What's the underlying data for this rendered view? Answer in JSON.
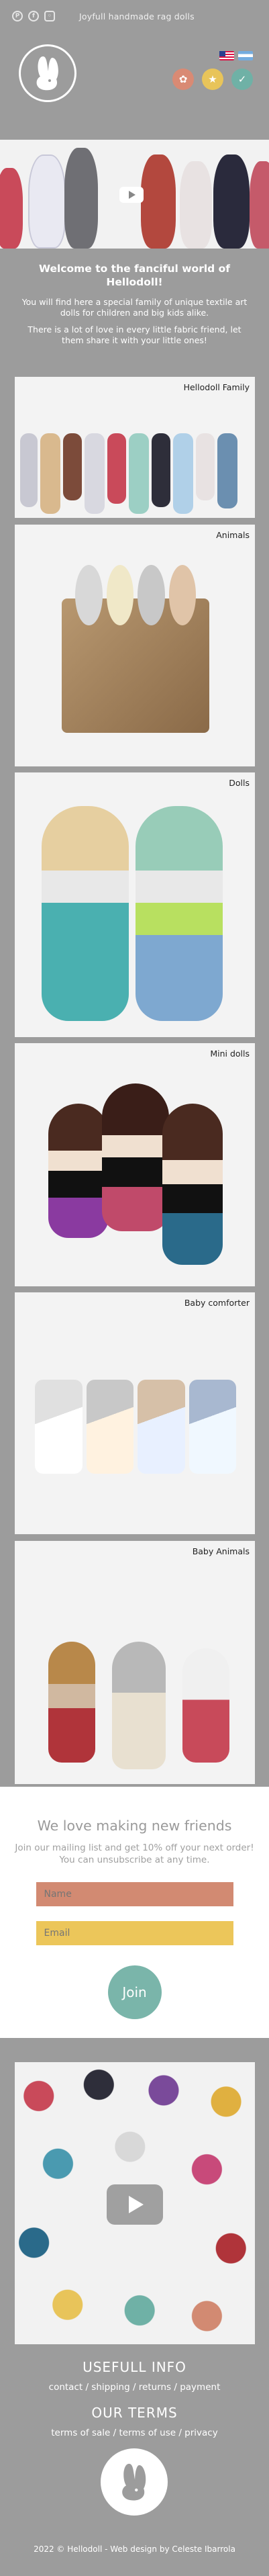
{
  "topbar": {
    "social": [
      "pinterest-icon",
      "facebook-icon",
      "instagram-icon"
    ],
    "tagline": "Joyfull handmade rag dolls"
  },
  "header": {
    "logo_text": "Hellodoll",
    "flags": [
      "us-flag",
      "argentina-flag"
    ],
    "badges": [
      {
        "icon": "handmade-icon",
        "color": "#d98a74"
      },
      {
        "icon": "star-icon",
        "color": "#e8c45a"
      },
      {
        "icon": "check-icon",
        "color": "#6fb1a6"
      }
    ]
  },
  "welcome": {
    "title": "Welcome to the fanciful world of Hellodoll!",
    "p1": "You will find here a special family of unique textile art dolls for children and big kids alike.",
    "p2": "There is a lot of love in every little fabric friend, let them share it with your little ones!"
  },
  "categories": [
    {
      "label": "Hellodoll Family"
    },
    {
      "label": "Animals"
    },
    {
      "label": "Dolls"
    },
    {
      "label": "Mini dolls"
    },
    {
      "label": "Baby comforter"
    },
    {
      "label": "Baby Animals"
    }
  ],
  "newsletter": {
    "title": "We love making new friends",
    "text": "Join our mailing list and get 10% off your next order! You can unsubscribe at any time.",
    "name_placeholder": "Name",
    "email_placeholder": "Email",
    "join_label": "Join"
  },
  "footer": {
    "info_title": "USEFULL INFO",
    "info_links": "contact / shipping / returns / payment",
    "terms_title": "OUR TERMS",
    "terms_links": "terms of sale / terms of use / privacy",
    "copyright": "2022 © Hellodoll - Web design by Celeste Ibarrola"
  },
  "colors": {
    "background": "#9c9c9c",
    "accent_red": "#d28a72",
    "accent_yellow": "#ecc65a",
    "accent_teal": "#7ab5aa"
  }
}
